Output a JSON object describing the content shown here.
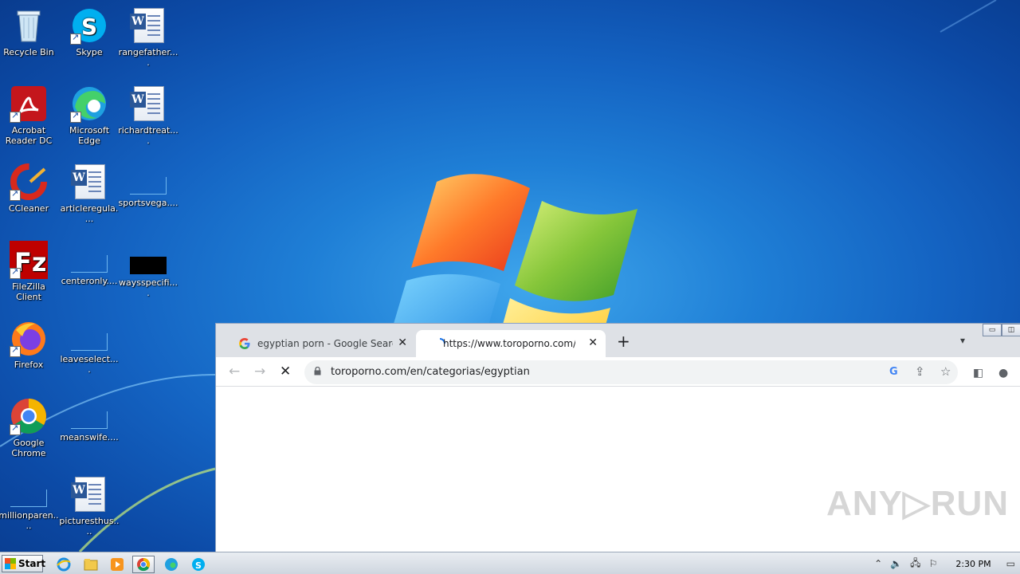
{
  "desktop": {
    "icons": [
      {
        "label": "Recycle Bin",
        "icon": "recycle-bin-icon"
      },
      {
        "label": "Skype",
        "icon": "skype-icon"
      },
      {
        "label": "rangefather....",
        "icon": "word-document-icon"
      },
      {
        "label": "Acrobat Reader DC",
        "icon": "acrobat-icon"
      },
      {
        "label": "Microsoft Edge",
        "icon": "edge-icon"
      },
      {
        "label": "richardtreat....",
        "icon": "word-document-icon"
      },
      {
        "label": "CCleaner",
        "icon": "ccleaner-icon"
      },
      {
        "label": "articleregula....",
        "icon": "word-document-icon"
      },
      {
        "label": "sportsvega....",
        "icon": "blank-file-icon"
      },
      {
        "label": "FileZilla Client",
        "icon": "filezilla-icon"
      },
      {
        "label": "centeronly....",
        "icon": "blank-file-icon"
      },
      {
        "label": "waysspecifi....",
        "icon": "black-file-icon"
      },
      {
        "label": "Firefox",
        "icon": "firefox-icon"
      },
      {
        "label": "leaveselect....",
        "icon": "blank-file-icon"
      },
      {
        "label": "Google Chrome",
        "icon": "chrome-icon"
      },
      {
        "label": "meanswife....",
        "icon": "blank-file-icon"
      },
      {
        "label": "millionparen....",
        "icon": "blank-file-icon"
      },
      {
        "label": "picturesthus....",
        "icon": "word-document-icon"
      }
    ]
  },
  "browser": {
    "tabs": [
      {
        "title": "egyptian porn - Google Search",
        "active": false
      },
      {
        "title": "https://www.toroporno.com/en/cate",
        "active": true
      }
    ],
    "new_tab": "+",
    "tab_menu": "⌄",
    "address": "toroporno.com/en/categorias/egyptian",
    "watermark": "ANY▷RUN"
  },
  "taskbar": {
    "start_label": "Start",
    "clock": "2:30 PM"
  },
  "colors": {
    "desktop_bg": "#1463c2",
    "tab_strip": "#dee1e6",
    "omnibox": "#f1f3f4"
  }
}
